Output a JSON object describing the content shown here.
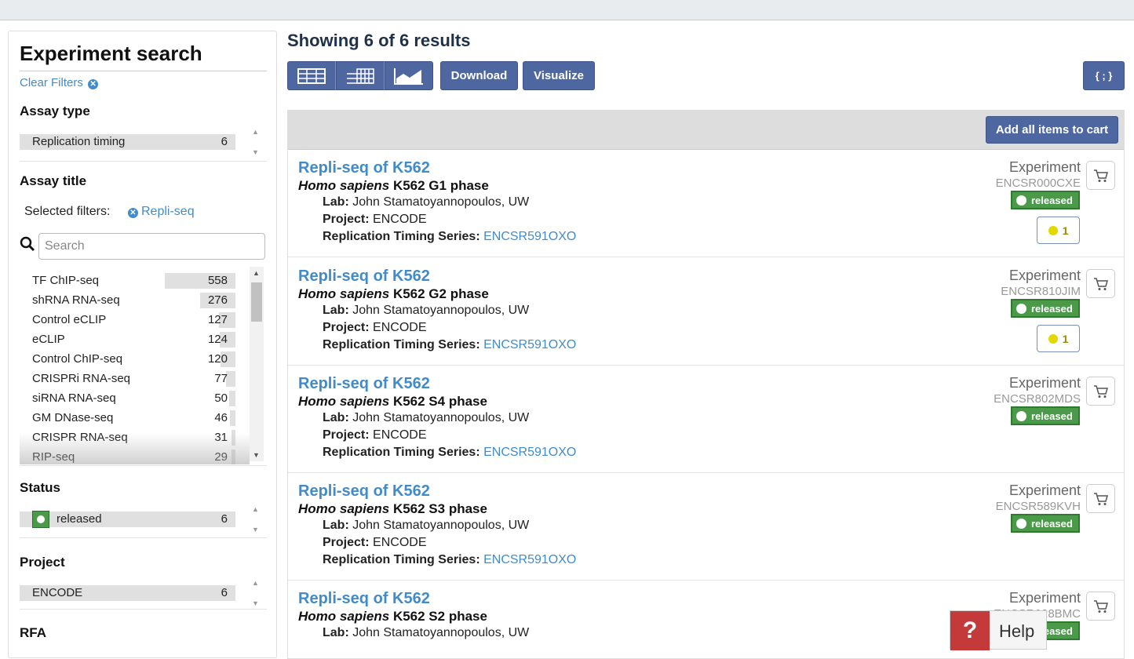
{
  "sidebar": {
    "title": "Experiment search",
    "clear_filters": "Clear Filters",
    "assay_type": {
      "title": "Assay type",
      "terms": [
        {
          "label": "Replication timing",
          "count": "6"
        }
      ]
    },
    "assay_title": {
      "title": "Assay title",
      "selected_label": "Selected filters:",
      "selected_value": "Repli-seq",
      "search_placeholder": "Search",
      "terms": [
        {
          "label": "TF ChIP-seq",
          "count": "558"
        },
        {
          "label": "shRNA RNA-seq",
          "count": "276"
        },
        {
          "label": "Control eCLIP",
          "count": "127"
        },
        {
          "label": "eCLIP",
          "count": "124"
        },
        {
          "label": "Control ChIP-seq",
          "count": "120"
        },
        {
          "label": "CRISPRi RNA-seq",
          "count": "77"
        },
        {
          "label": "siRNA RNA-seq",
          "count": "50"
        },
        {
          "label": "GM DNase-seq",
          "count": "46"
        },
        {
          "label": "CRISPR RNA-seq",
          "count": "31"
        },
        {
          "label": "RIP-seq",
          "count": "29"
        }
      ]
    },
    "status": {
      "title": "Status",
      "terms": [
        {
          "label": "released",
          "count": "6"
        }
      ]
    },
    "project": {
      "title": "Project",
      "terms": [
        {
          "label": "ENCODE",
          "count": "6"
        }
      ]
    },
    "rfa": {
      "title": "RFA"
    }
  },
  "main": {
    "heading": "Showing 6 of 6 results",
    "download": "Download",
    "visualize": "Visualize",
    "json_button": "{ ; }",
    "add_all": "Add all items to cart"
  },
  "labels": {
    "lab": "Lab:",
    "project": "Project:",
    "series": "Replication Timing Series:",
    "species": "Homo sapiens"
  },
  "results": [
    {
      "title": "Repli-seq of K562",
      "subtitle": "K562 G1 phase",
      "lab": "John Stamatoyannopoulos, UW",
      "project": "ENCODE",
      "series": "ENCSR591OXO",
      "type": "Experiment",
      "accession": "ENCSR000CXE",
      "status": "released",
      "audit": "1"
    },
    {
      "title": "Repli-seq of K562",
      "subtitle": "K562 G2 phase",
      "lab": "John Stamatoyannopoulos, UW",
      "project": "ENCODE",
      "series": "ENCSR591OXO",
      "type": "Experiment",
      "accession": "ENCSR810JIM",
      "status": "released",
      "audit": "1"
    },
    {
      "title": "Repli-seq of K562",
      "subtitle": "K562 S4 phase",
      "lab": "John Stamatoyannopoulos, UW",
      "project": "ENCODE",
      "series": "ENCSR591OXO",
      "type": "Experiment",
      "accession": "ENCSR802MDS",
      "status": "released"
    },
    {
      "title": "Repli-seq of K562",
      "subtitle": "K562 S3 phase",
      "lab": "John Stamatoyannopoulos, UW",
      "project": "ENCODE",
      "series": "ENCSR591OXO",
      "type": "Experiment",
      "accession": "ENCSR589KVH",
      "status": "released"
    },
    {
      "title": "Repli-seq of K562",
      "subtitle": "K562 S2 phase",
      "lab": "John Stamatoyannopoulos, UW",
      "type": "Experiment",
      "accession": "ENCSR028BMC",
      "status": "released"
    }
  ],
  "help": "Help",
  "colors": {
    "accent": "#4e67a0",
    "link": "#428bca",
    "released": "#4a9a4a",
    "audit_yellow": "#e2d800",
    "help_red": "#c43a3a"
  }
}
